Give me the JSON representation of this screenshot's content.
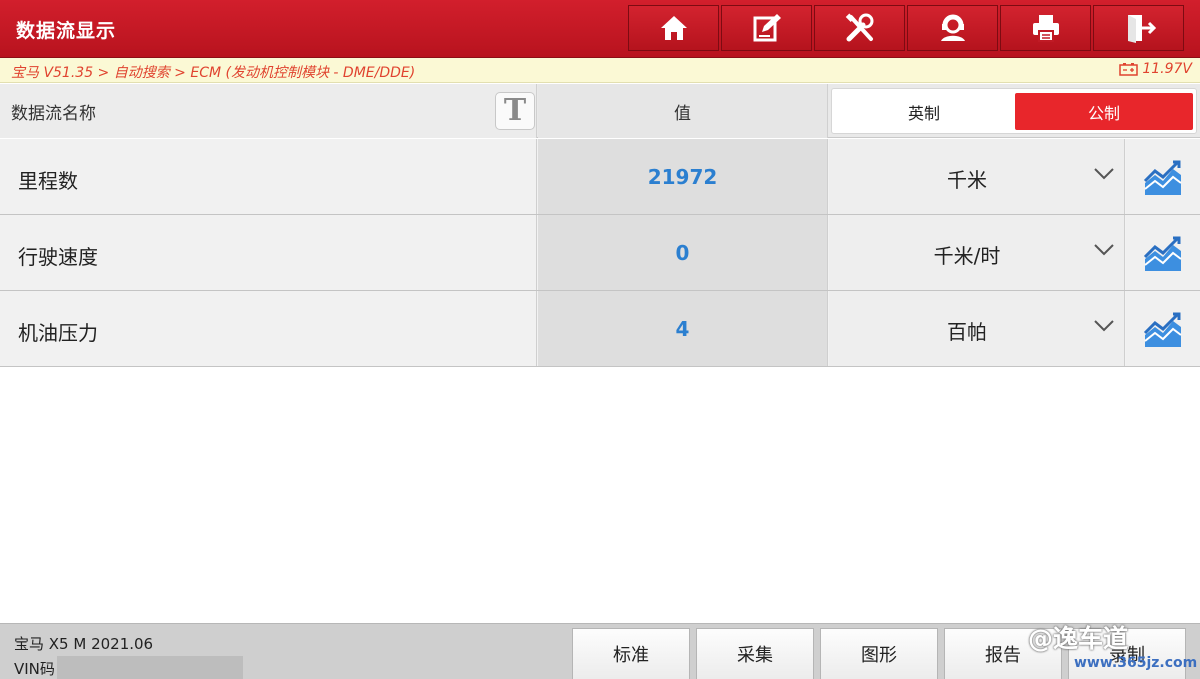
{
  "app": {
    "title": "数据流显示"
  },
  "toolbar": {
    "icons": [
      "home-icon",
      "edit-icon",
      "tools-icon",
      "support-icon",
      "print-icon",
      "exit-icon"
    ]
  },
  "breadcrumb": {
    "path": "宝马 V51.35 > 自动搜索 > ECM (发动机控制模块 - DME/DDE)",
    "voltage": "11.97V"
  },
  "table": {
    "col_name": "数据流名称",
    "col_value": "值",
    "text_size_icon": "T",
    "unit_toggle": {
      "imperial": "英制",
      "metric": "公制",
      "selected": "metric"
    },
    "rows": [
      {
        "name": "里程数",
        "value": "21972",
        "unit": "千米"
      },
      {
        "name": "行驶速度",
        "value": "0",
        "unit": "千米/时"
      },
      {
        "name": "机油压力",
        "value": "4",
        "unit": "百帕"
      }
    ]
  },
  "footer": {
    "vehicle": "宝马 X5 M 2021.06",
    "vin_label": "VIN码",
    "buttons": [
      "标准",
      "采集",
      "图形",
      "报告",
      "录制"
    ]
  },
  "watermark": {
    "main": "@逸车道",
    "url": "www.365jz.com"
  },
  "colors": {
    "brand_red": "#c8182a",
    "value_blue": "#2b7fd0",
    "crumb_orange": "#e0432f",
    "toggle_active": "#e8262b"
  }
}
